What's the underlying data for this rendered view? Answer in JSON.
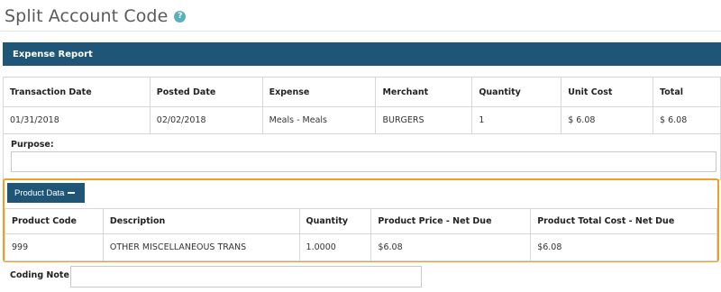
{
  "page": {
    "title": "Split Account Code",
    "help_icon": "?"
  },
  "report": {
    "header": "Expense Report",
    "columns": [
      "Transaction Date",
      "Posted Date",
      "Expense",
      "Merchant",
      "Quantity",
      "Unit Cost",
      "Total"
    ],
    "row": [
      "01/31/2018",
      "02/02/2018",
      "Meals - Meals",
      "BURGERS",
      "1",
      "$ 6.08",
      "$ 6.08"
    ]
  },
  "purpose": {
    "label": "Purpose:",
    "value": ""
  },
  "product_data": {
    "button_label": "Product Data",
    "columns": [
      "Product Code",
      "Description",
      "Quantity",
      "Product Price - Net Due",
      "Product Total Cost - Net Due"
    ],
    "row": [
      "999",
      "OTHER MISCELLANEOUS TRANS",
      "1.0000",
      "$6.08",
      "$6.08"
    ]
  },
  "coding_note": {
    "label": "Coding Note:",
    "value": ""
  },
  "colors": {
    "header_bg": "#1f5677",
    "highlight": "#f0a020",
    "help_icon": "#5bb0c0"
  }
}
